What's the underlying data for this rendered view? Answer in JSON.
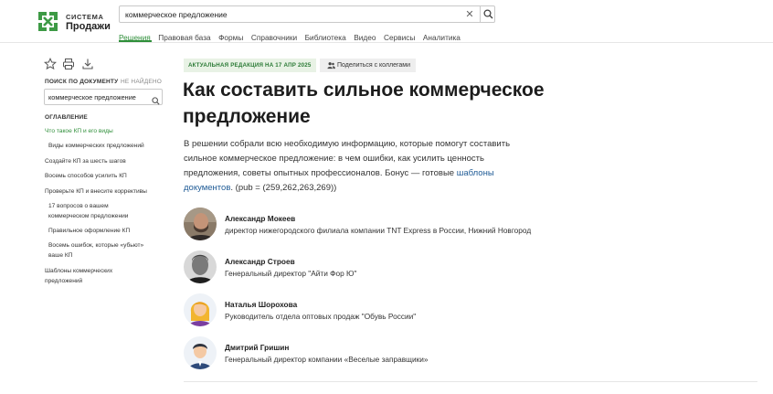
{
  "header": {
    "logo_line1": "СИСТЕМА",
    "logo_line2": "Продажи",
    "search_value": "коммерческое предложение",
    "clear_icon": "close-icon",
    "search_icon": "search-icon"
  },
  "nav": {
    "items": [
      "Решения",
      "Правовая база",
      "Формы",
      "Справочники",
      "Библиотека",
      "Видео",
      "Сервисы",
      "Аналитика"
    ],
    "active": "Решения"
  },
  "sidebar": {
    "icons": [
      "star-icon",
      "print-icon",
      "download-icon"
    ],
    "doc_search_label": "ПОИСК ПО ДОКУМЕНТУ",
    "doc_search_status": "НЕ НАЙДЕНО",
    "doc_search_value": "коммерческое предложение",
    "toc_label": "ОГЛАВЛЕНИЕ",
    "toc": [
      "Что такое КП и его виды",
      "Виды коммерческих предложений",
      "Создайте КП за шесть шагов",
      "Восемь способов усилить КП",
      "Проверьте КП и внесите коррективы",
      "17 вопросов о вашем",
      "коммерческом предложении",
      "Правильное оформление КП",
      "Восемь ошибок, которые «убьют»",
      "ваше КП",
      "Шаблоны коммерческих",
      "предложений"
    ]
  },
  "article": {
    "badge": "АКТУАЛЬНАЯ РЕДАКЦИЯ НА 17 АПР 2025",
    "share_label": "Поделиться с коллегами",
    "title_line1": "Как составить сильное коммерческое",
    "title_line2": "предложение",
    "lead_line1": "В решении собрали всю необходимую информацию, которые помогут составить",
    "lead_line2": "сильное коммерческое предложение: в чем ошибки, как усилить ценность",
    "lead_line3_pre": "предложения, советы опытных профессионалов. Бонус — готовые ",
    "lead_link1": "шаблоны",
    "lead_link2": "документов",
    "lead_tail": ". (pub = (259,262,263,269))"
  },
  "experts": [
    {
      "name": "Александр Мокеев",
      "role": "директор нижегородского филиала компании TNT Express в России, Нижний Новгород"
    },
    {
      "name": "Александр Строев",
      "role": "Генеральный директор \"Айти Фор Ю\""
    },
    {
      "name": "Наталья  Шорохова",
      "role": "Руководитель отдела оптовых продаж \"Обувь России\""
    },
    {
      "name": "Дмитрий Гришин",
      "role": "Генеральный директор компании «Веселые заправщики»"
    }
  ]
}
